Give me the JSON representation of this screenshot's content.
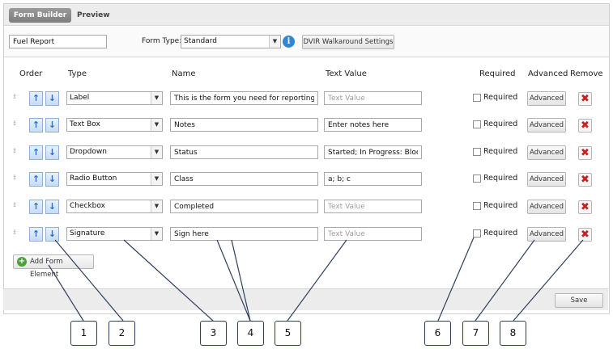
{
  "tabs": {
    "active": "Form Builder",
    "preview": "Preview"
  },
  "form": {
    "name": "Fuel Report",
    "type_label": "Form Type:",
    "type_value": "Standard",
    "dvir_button": "DVIR Walkaround Settings"
  },
  "headers": {
    "order": "Order",
    "type": "Type",
    "name": "Name",
    "text_value": "Text Value",
    "required": "Required",
    "advanced": "Advanced",
    "remove": "Remove"
  },
  "rows": [
    {
      "type": "Label",
      "name": "This is the form you need for reporting or",
      "text_value": "",
      "text_placeholder": "Text Value",
      "required_label": "Required",
      "advanced_label": "Advanced"
    },
    {
      "type": "Text Box",
      "name": "Notes",
      "text_value": "Enter notes here",
      "text_placeholder": "Text Value",
      "required_label": "Required",
      "advanced_label": "Advanced"
    },
    {
      "type": "Dropdown",
      "name": "Status",
      "text_value": "Started; In Progress: Block",
      "text_placeholder": "Text Value",
      "required_label": "Required",
      "advanced_label": "Advanced"
    },
    {
      "type": "Radio Button",
      "name": "Class",
      "text_value": "a; b; c",
      "text_placeholder": "Text Value",
      "required_label": "Required",
      "advanced_label": "Advanced"
    },
    {
      "type": "Checkbox",
      "name": "Completed",
      "text_value": "",
      "text_placeholder": "Text Value",
      "required_label": "Required",
      "advanced_label": "Advanced"
    },
    {
      "type": "Signature",
      "name": "Sign here",
      "text_value": "",
      "text_placeholder": "Text Value",
      "required_label": "Required",
      "advanced_label": "Advanced"
    }
  ],
  "add_button": "Add Form Element",
  "save_button": "Save",
  "callouts": [
    "1",
    "2",
    "3",
    "4",
    "5",
    "6",
    "7",
    "8"
  ],
  "icons": {
    "up": "arrow-up-icon",
    "down": "arrow-down-icon",
    "remove": "red-x-icon",
    "info": "info-icon",
    "add": "plus-circle-icon",
    "grip": "drag-handle-icon"
  }
}
